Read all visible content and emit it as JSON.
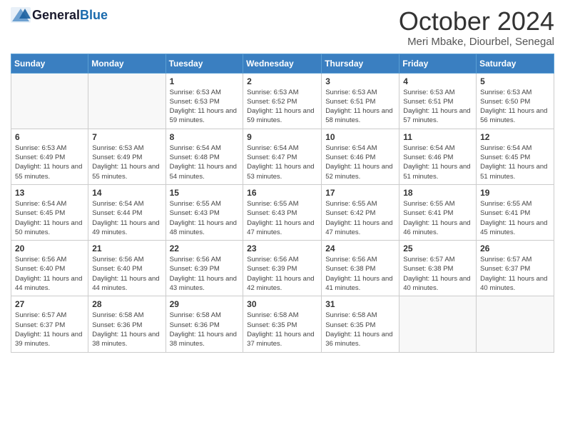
{
  "logo": {
    "general": "General",
    "blue": "Blue"
  },
  "header": {
    "month": "October 2024",
    "location": "Meri Mbake, Diourbel, Senegal"
  },
  "days_of_week": [
    "Sunday",
    "Monday",
    "Tuesday",
    "Wednesday",
    "Thursday",
    "Friday",
    "Saturday"
  ],
  "weeks": [
    [
      {
        "day": "",
        "sunrise": "",
        "sunset": "",
        "daylight": ""
      },
      {
        "day": "",
        "sunrise": "",
        "sunset": "",
        "daylight": ""
      },
      {
        "day": "1",
        "sunrise": "Sunrise: 6:53 AM",
        "sunset": "Sunset: 6:53 PM",
        "daylight": "Daylight: 11 hours and 59 minutes."
      },
      {
        "day": "2",
        "sunrise": "Sunrise: 6:53 AM",
        "sunset": "Sunset: 6:52 PM",
        "daylight": "Daylight: 11 hours and 59 minutes."
      },
      {
        "day": "3",
        "sunrise": "Sunrise: 6:53 AM",
        "sunset": "Sunset: 6:51 PM",
        "daylight": "Daylight: 11 hours and 58 minutes."
      },
      {
        "day": "4",
        "sunrise": "Sunrise: 6:53 AM",
        "sunset": "Sunset: 6:51 PM",
        "daylight": "Daylight: 11 hours and 57 minutes."
      },
      {
        "day": "5",
        "sunrise": "Sunrise: 6:53 AM",
        "sunset": "Sunset: 6:50 PM",
        "daylight": "Daylight: 11 hours and 56 minutes."
      }
    ],
    [
      {
        "day": "6",
        "sunrise": "Sunrise: 6:53 AM",
        "sunset": "Sunset: 6:49 PM",
        "daylight": "Daylight: 11 hours and 55 minutes."
      },
      {
        "day": "7",
        "sunrise": "Sunrise: 6:53 AM",
        "sunset": "Sunset: 6:49 PM",
        "daylight": "Daylight: 11 hours and 55 minutes."
      },
      {
        "day": "8",
        "sunrise": "Sunrise: 6:54 AM",
        "sunset": "Sunset: 6:48 PM",
        "daylight": "Daylight: 11 hours and 54 minutes."
      },
      {
        "day": "9",
        "sunrise": "Sunrise: 6:54 AM",
        "sunset": "Sunset: 6:47 PM",
        "daylight": "Daylight: 11 hours and 53 minutes."
      },
      {
        "day": "10",
        "sunrise": "Sunrise: 6:54 AM",
        "sunset": "Sunset: 6:46 PM",
        "daylight": "Daylight: 11 hours and 52 minutes."
      },
      {
        "day": "11",
        "sunrise": "Sunrise: 6:54 AM",
        "sunset": "Sunset: 6:46 PM",
        "daylight": "Daylight: 11 hours and 51 minutes."
      },
      {
        "day": "12",
        "sunrise": "Sunrise: 6:54 AM",
        "sunset": "Sunset: 6:45 PM",
        "daylight": "Daylight: 11 hours and 51 minutes."
      }
    ],
    [
      {
        "day": "13",
        "sunrise": "Sunrise: 6:54 AM",
        "sunset": "Sunset: 6:45 PM",
        "daylight": "Daylight: 11 hours and 50 minutes."
      },
      {
        "day": "14",
        "sunrise": "Sunrise: 6:54 AM",
        "sunset": "Sunset: 6:44 PM",
        "daylight": "Daylight: 11 hours and 49 minutes."
      },
      {
        "day": "15",
        "sunrise": "Sunrise: 6:55 AM",
        "sunset": "Sunset: 6:43 PM",
        "daylight": "Daylight: 11 hours and 48 minutes."
      },
      {
        "day": "16",
        "sunrise": "Sunrise: 6:55 AM",
        "sunset": "Sunset: 6:43 PM",
        "daylight": "Daylight: 11 hours and 47 minutes."
      },
      {
        "day": "17",
        "sunrise": "Sunrise: 6:55 AM",
        "sunset": "Sunset: 6:42 PM",
        "daylight": "Daylight: 11 hours and 47 minutes."
      },
      {
        "day": "18",
        "sunrise": "Sunrise: 6:55 AM",
        "sunset": "Sunset: 6:41 PM",
        "daylight": "Daylight: 11 hours and 46 minutes."
      },
      {
        "day": "19",
        "sunrise": "Sunrise: 6:55 AM",
        "sunset": "Sunset: 6:41 PM",
        "daylight": "Daylight: 11 hours and 45 minutes."
      }
    ],
    [
      {
        "day": "20",
        "sunrise": "Sunrise: 6:56 AM",
        "sunset": "Sunset: 6:40 PM",
        "daylight": "Daylight: 11 hours and 44 minutes."
      },
      {
        "day": "21",
        "sunrise": "Sunrise: 6:56 AM",
        "sunset": "Sunset: 6:40 PM",
        "daylight": "Daylight: 11 hours and 44 minutes."
      },
      {
        "day": "22",
        "sunrise": "Sunrise: 6:56 AM",
        "sunset": "Sunset: 6:39 PM",
        "daylight": "Daylight: 11 hours and 43 minutes."
      },
      {
        "day": "23",
        "sunrise": "Sunrise: 6:56 AM",
        "sunset": "Sunset: 6:39 PM",
        "daylight": "Daylight: 11 hours and 42 minutes."
      },
      {
        "day": "24",
        "sunrise": "Sunrise: 6:56 AM",
        "sunset": "Sunset: 6:38 PM",
        "daylight": "Daylight: 11 hours and 41 minutes."
      },
      {
        "day": "25",
        "sunrise": "Sunrise: 6:57 AM",
        "sunset": "Sunset: 6:38 PM",
        "daylight": "Daylight: 11 hours and 40 minutes."
      },
      {
        "day": "26",
        "sunrise": "Sunrise: 6:57 AM",
        "sunset": "Sunset: 6:37 PM",
        "daylight": "Daylight: 11 hours and 40 minutes."
      }
    ],
    [
      {
        "day": "27",
        "sunrise": "Sunrise: 6:57 AM",
        "sunset": "Sunset: 6:37 PM",
        "daylight": "Daylight: 11 hours and 39 minutes."
      },
      {
        "day": "28",
        "sunrise": "Sunrise: 6:58 AM",
        "sunset": "Sunset: 6:36 PM",
        "daylight": "Daylight: 11 hours and 38 minutes."
      },
      {
        "day": "29",
        "sunrise": "Sunrise: 6:58 AM",
        "sunset": "Sunset: 6:36 PM",
        "daylight": "Daylight: 11 hours and 38 minutes."
      },
      {
        "day": "30",
        "sunrise": "Sunrise: 6:58 AM",
        "sunset": "Sunset: 6:35 PM",
        "daylight": "Daylight: 11 hours and 37 minutes."
      },
      {
        "day": "31",
        "sunrise": "Sunrise: 6:58 AM",
        "sunset": "Sunset: 6:35 PM",
        "daylight": "Daylight: 11 hours and 36 minutes."
      },
      {
        "day": "",
        "sunrise": "",
        "sunset": "",
        "daylight": ""
      },
      {
        "day": "",
        "sunrise": "",
        "sunset": "",
        "daylight": ""
      }
    ]
  ]
}
